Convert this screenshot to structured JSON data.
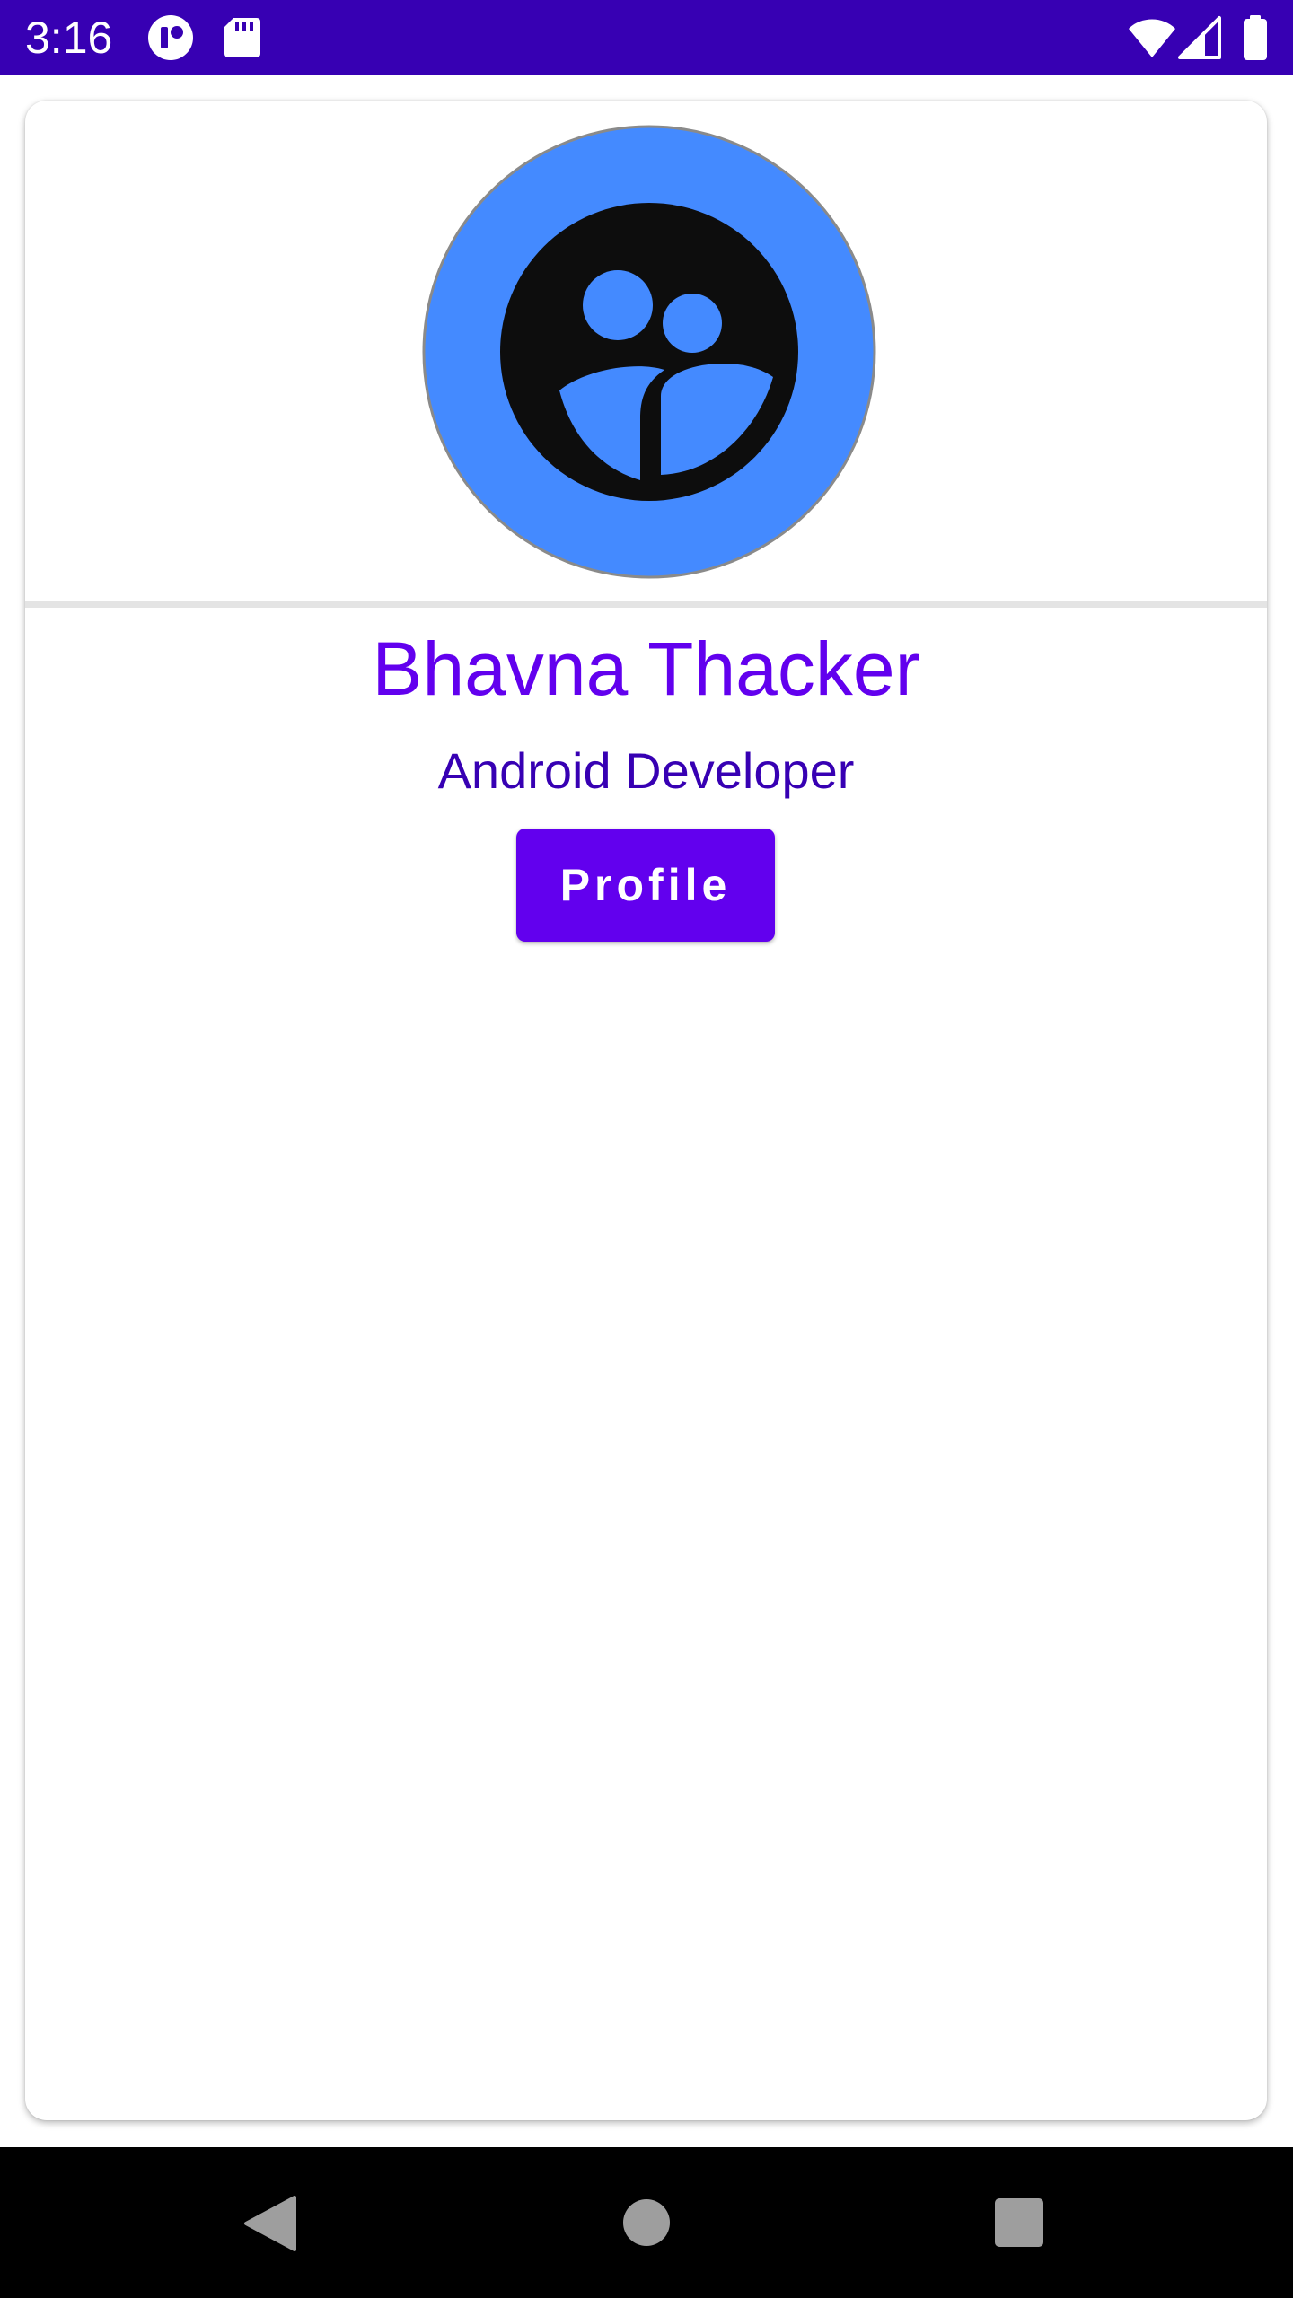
{
  "status_bar": {
    "time": "3:16",
    "icons": [
      "notification-app-icon",
      "sd-card-icon",
      "wifi-icon",
      "cellular-signal-icon",
      "battery-icon"
    ],
    "background": "#3700b3"
  },
  "profile": {
    "name": "Bhavna Thacker",
    "role": "Android Developer",
    "button_label": "Profile",
    "avatar_icon": "group-avatar-icon",
    "avatar_color": "#448aff"
  },
  "navigation": {
    "back": "back-icon",
    "home": "home-icon",
    "recents": "recents-icon"
  },
  "colors": {
    "primary": "#6200ee",
    "primary_dark": "#3700b3"
  }
}
